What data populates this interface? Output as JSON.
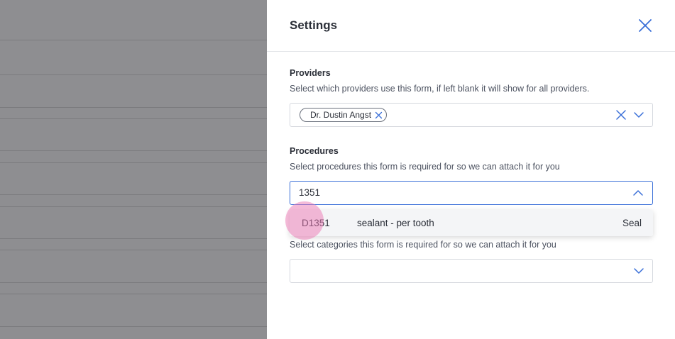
{
  "panel": {
    "title": "Settings"
  },
  "providers": {
    "label": "Providers",
    "description": "Select which providers use this form, if left blank it will show for all providers.",
    "selected": [
      "Dr. Dustin Angst"
    ]
  },
  "procedures": {
    "label": "Procedures",
    "description": "Select procedures this form is required for so we can attach it for you",
    "input_value": "1351",
    "options": [
      {
        "code": "D1351",
        "description": "sealant - per tooth",
        "category": "Seal"
      }
    ]
  },
  "categories": {
    "description": "Select categories this form is required for so we can attach it for you",
    "value": ""
  },
  "colors": {
    "accent": "#3a6fd8",
    "text": "#2b2f38",
    "backdrop": "#8e8e91"
  }
}
